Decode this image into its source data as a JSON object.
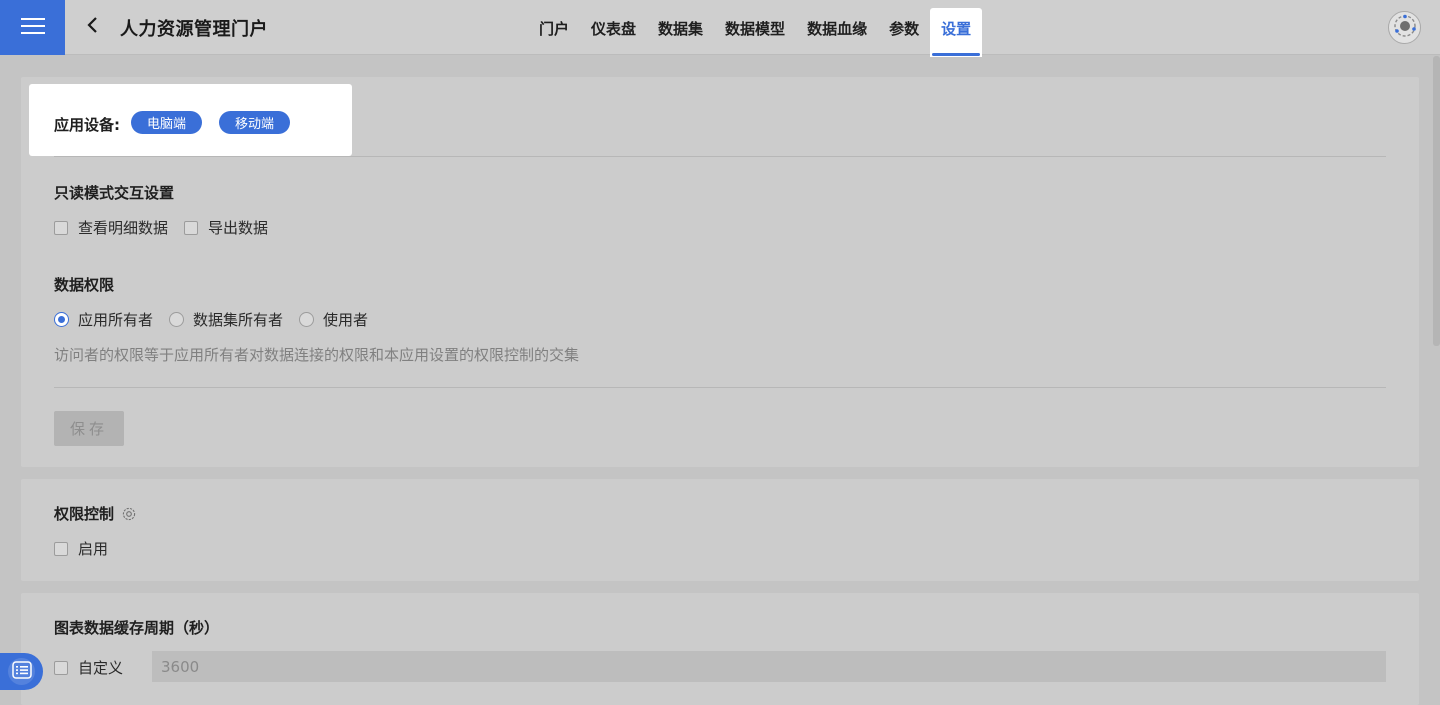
{
  "header": {
    "app_title": "人力资源管理门户",
    "nav": [
      "门户",
      "仪表盘",
      "数据集",
      "数据模型",
      "数据血缘",
      "参数",
      "设置"
    ],
    "active_tab": "设置",
    "accent": "#3a6fd8"
  },
  "device": {
    "label": "应用设备:",
    "options": [
      "电脑端",
      "移动端"
    ]
  },
  "readonly": {
    "title": "只读模式交互设置",
    "options": [
      "查看明细数据",
      "导出数据"
    ]
  },
  "data_permission": {
    "title": "数据权限",
    "options": [
      "应用所有者",
      "数据集所有者",
      "使用者"
    ],
    "selected": "应用所有者",
    "hint": "访问者的权限等于应用所有者对数据连接的权限和本应用设置的权限控制的交集"
  },
  "save_label": "保存",
  "permission_control": {
    "title": "权限控制",
    "enable_label": "启用"
  },
  "cache": {
    "title": "图表数据缓存周期（秒）",
    "custom_label": "自定义",
    "value": "3600"
  },
  "icons": {
    "menu": "hamburger-icon",
    "back": "chevron-left-icon",
    "avatar": "avatar-icon",
    "settings": "gear-icon",
    "float": "list-icon"
  }
}
